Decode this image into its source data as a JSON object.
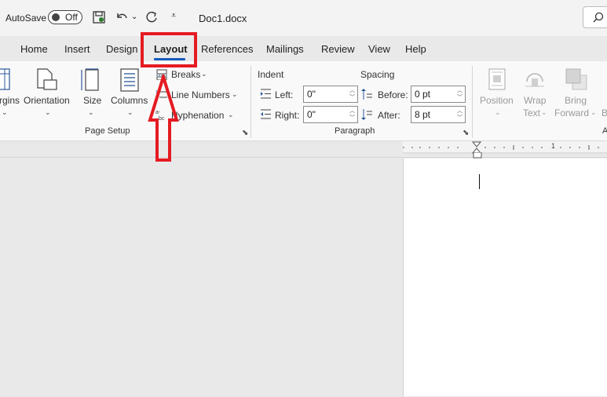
{
  "titlebar": {
    "autosave_label": "AutoSave",
    "autosave_state": "Off",
    "doc_title": "Doc1.docx"
  },
  "tabs": [
    {
      "label": "Home"
    },
    {
      "label": "Insert"
    },
    {
      "label": "Design"
    },
    {
      "label": "Layout"
    },
    {
      "label": "References"
    },
    {
      "label": "Mailings"
    },
    {
      "label": "Review"
    },
    {
      "label": "View"
    },
    {
      "label": "Help"
    }
  ],
  "page_setup": {
    "margins_label": "rgins",
    "orientation_label": "Orientation",
    "size_label": "Size",
    "columns_label": "Columns",
    "breaks_label": "Breaks",
    "line_numbers_label": "Line Numbers",
    "hyphenation_label": "Hyphenation",
    "group_label": "Page Setup"
  },
  "paragraph": {
    "indent_header": "Indent",
    "spacing_header": "Spacing",
    "left_label": "Left:",
    "left_value": "0\"",
    "right_label": "Right:",
    "right_value": "0\"",
    "before_label": "Before:",
    "before_value": "0 pt",
    "after_label": "After:",
    "after_value": "8 pt",
    "group_label": "Paragraph"
  },
  "arrange": {
    "position_label": "Position",
    "wrap_label": "Wrap",
    "wrap_label2": "Text",
    "bring_label": "Bring",
    "bring_label2": "Forward",
    "group_label_partial": "A"
  },
  "ruler": {
    "mark_1": "1"
  },
  "colors": {
    "accent": "#185abd",
    "annotation": "#e51b22"
  }
}
